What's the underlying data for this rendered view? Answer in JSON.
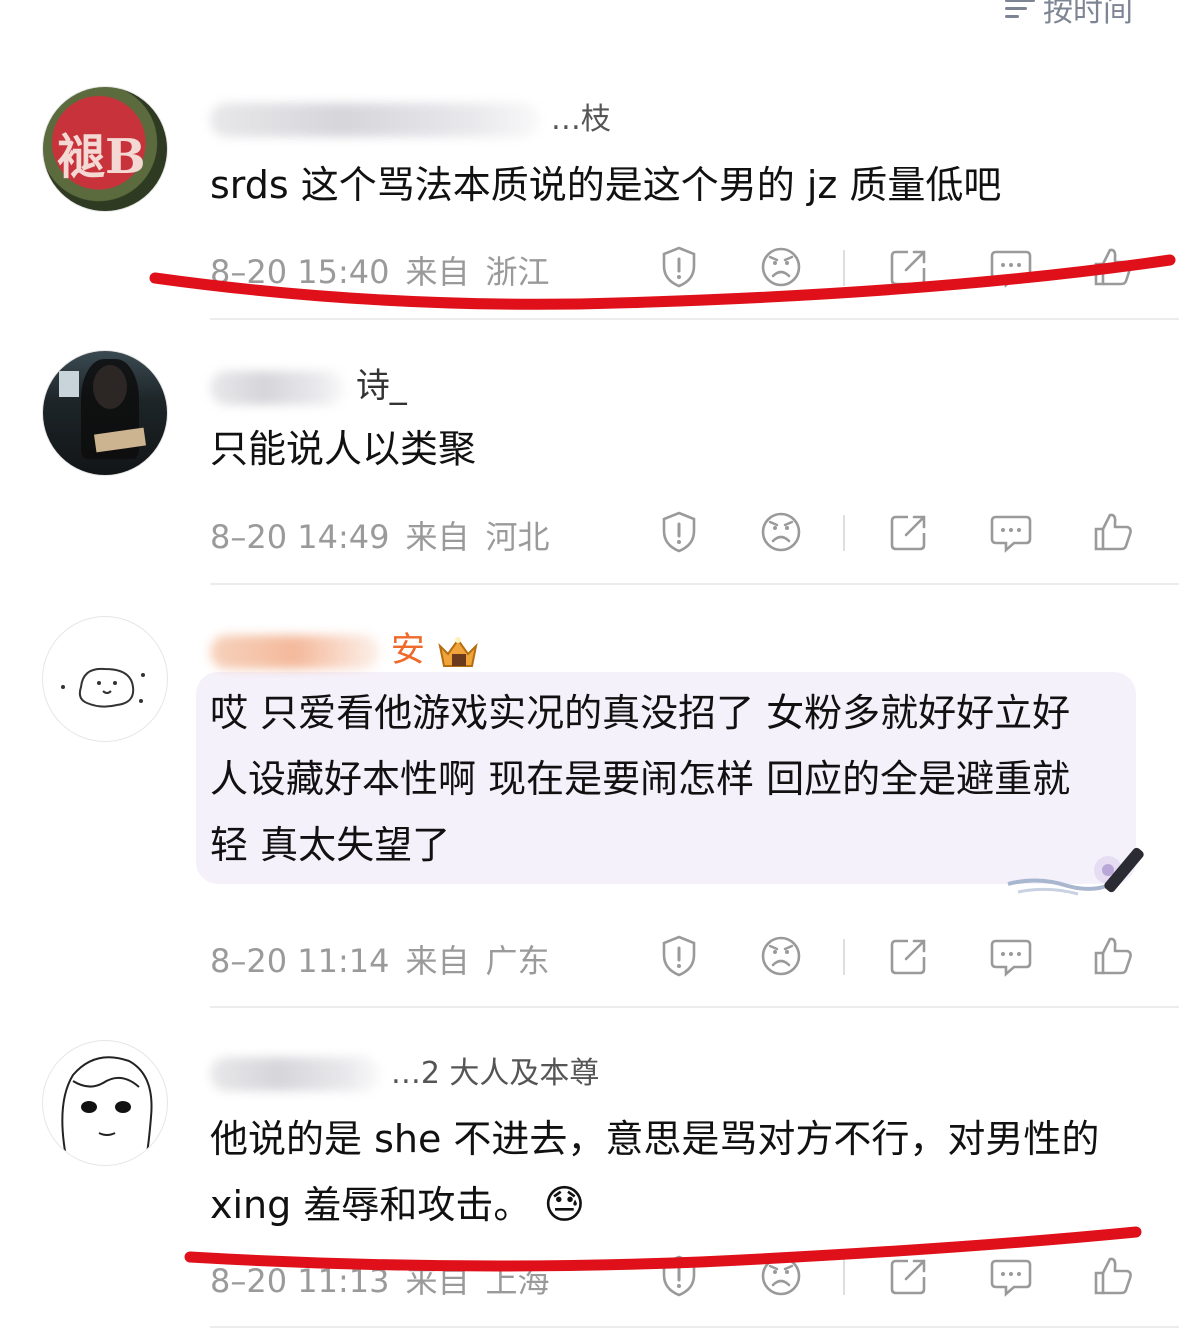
{
  "header": {
    "sort_label": "按时间"
  },
  "comments": [
    {
      "username_visible": "…枝",
      "text": "srds 这个骂法本质说的是这个男的 jz 质量低吧",
      "time": "8–20 15:40",
      "from": "来自",
      "region": "浙江",
      "avatar_text": "褪B"
    },
    {
      "username_visible": "诗_",
      "text": "只能说人以类聚",
      "time": "8–20 14:49",
      "from": "来自",
      "region": "河北"
    },
    {
      "username_visible": "安",
      "text": "哎 只爱看他游戏实况的真没招了 女粉多就好好立好人设藏好本性啊 现在是要闹怎样 回应的全是避重就轻 真太失望了",
      "time": "8–20 11:14",
      "from": "来自",
      "region": "广东"
    },
    {
      "username_visible": "…2 大人及本尊",
      "text": "他说的是 she 不进去，意思是骂对方不行，对男性的 xing 羞辱和攻击。",
      "emoji": "😓",
      "time": "8–20 11:13",
      "from": "来自",
      "region": "上海"
    }
  ],
  "icons": [
    "report-icon",
    "dislike-icon",
    "share-icon",
    "reply-icon",
    "like-icon"
  ],
  "colors": {
    "annotation_red": "#e0101a",
    "vip_name": "#ef6a2a",
    "meta_gray": "#9a9a9a"
  }
}
